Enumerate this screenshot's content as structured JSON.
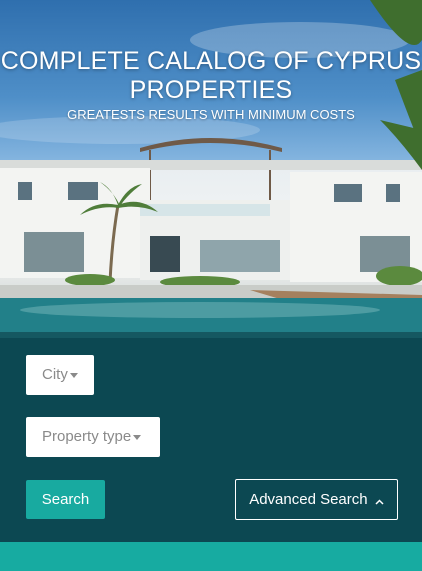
{
  "hero": {
    "title": "COMPLETE CALALOG OF CYPRUS PROPERTIES",
    "subtitle": "GREATESTS RESULTS WITH MINIMUM COSTS",
    "image_alt": "luxury villa with swimming pool"
  },
  "search": {
    "city_label": "City",
    "property_type_label": "Property type",
    "search_button": "Search",
    "advanced_button": "Advanced Search",
    "caret_icon": "caret-down-icon",
    "chevron_icon": "chevron-up-icon"
  },
  "colors": {
    "accent": "#18aaa0",
    "bottom_bar": "#17aba1",
    "overlay": "#062830"
  }
}
